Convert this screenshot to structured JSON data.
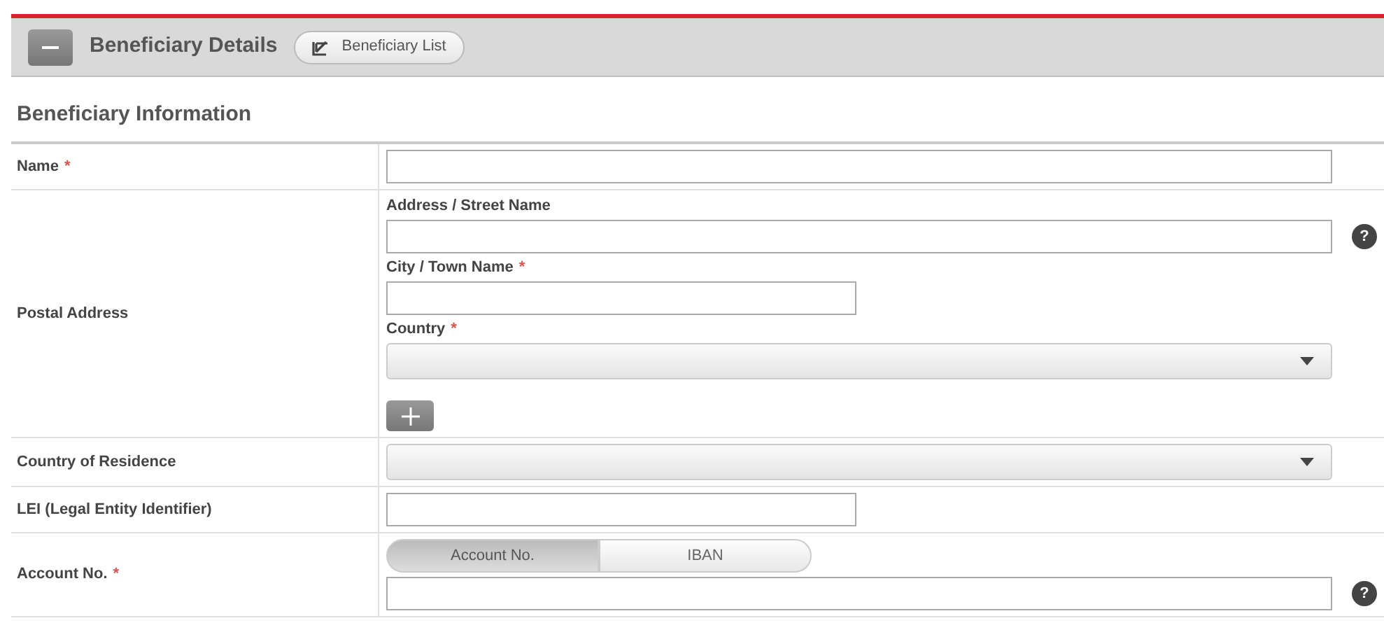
{
  "header": {
    "title": "Beneficiary Details",
    "list_button": "Beneficiary List"
  },
  "section_title": "Beneficiary Information",
  "rows": [
    {
      "label": "Name",
      "required_mark": "*",
      "fields": [
        {
          "kind": "long"
        }
      ]
    },
    {
      "label": "Postal Address",
      "fields": [
        {
          "kind": "long",
          "label": "Address / Street Name",
          "help": "?"
        },
        {
          "kind": "short",
          "label": "City / Town Name",
          "required_mark": "*"
        },
        {
          "kind": "select",
          "label": "Country",
          "required_mark": "*"
        },
        {
          "kind": "add"
        }
      ]
    },
    {
      "label": "Country of Residence",
      "fields": [
        {
          "kind": "select"
        }
      ]
    },
    {
      "label": "LEI (Legal Entity Identifier)",
      "fields": [
        {
          "kind": "short"
        }
      ]
    },
    {
      "label": "Account No.",
      "required_mark": "*",
      "fields": [
        {
          "kind": "toggle",
          "options": [
            {
              "label": "Account No.",
              "selected": true
            },
            {
              "label": "IBAN",
              "selected": false
            }
          ]
        },
        {
          "kind": "long",
          "help": "?"
        }
      ]
    }
  ]
}
